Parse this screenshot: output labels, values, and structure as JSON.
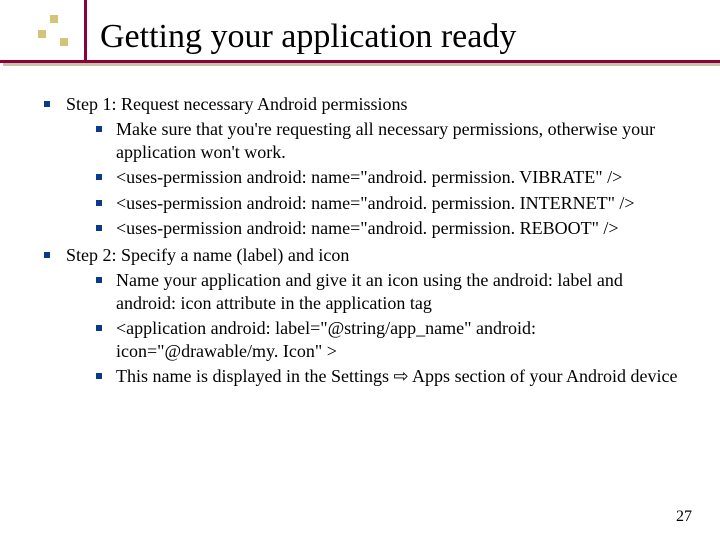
{
  "title": "Getting your application ready",
  "steps": [
    {
      "heading": "Step 1: Request necessary Android permissions",
      "items": [
        "Make sure that you're requesting all necessary permissions, otherwise your application won't work.",
        "<uses-permission  android: name=\"android. permission. VIBRATE\" />",
        "<uses-permission  android: name=\"android. permission. INTERNET\" />",
        "<uses-permission  android: name=\"android. permission. REBOOT\" />"
      ]
    },
    {
      "heading": "Step 2: Specify a name (label) and icon",
      "items": [
        "Name your application and give it an icon using the  android: label  and android: icon  attribute in the application tag",
        "<application  android: label=\"@string/app_name\" android: icon=\"@drawable/my. Icon\"   >",
        "This name is displayed in the Settings ⇨ Apps section of your Android device"
      ]
    }
  ],
  "page_number": "27"
}
